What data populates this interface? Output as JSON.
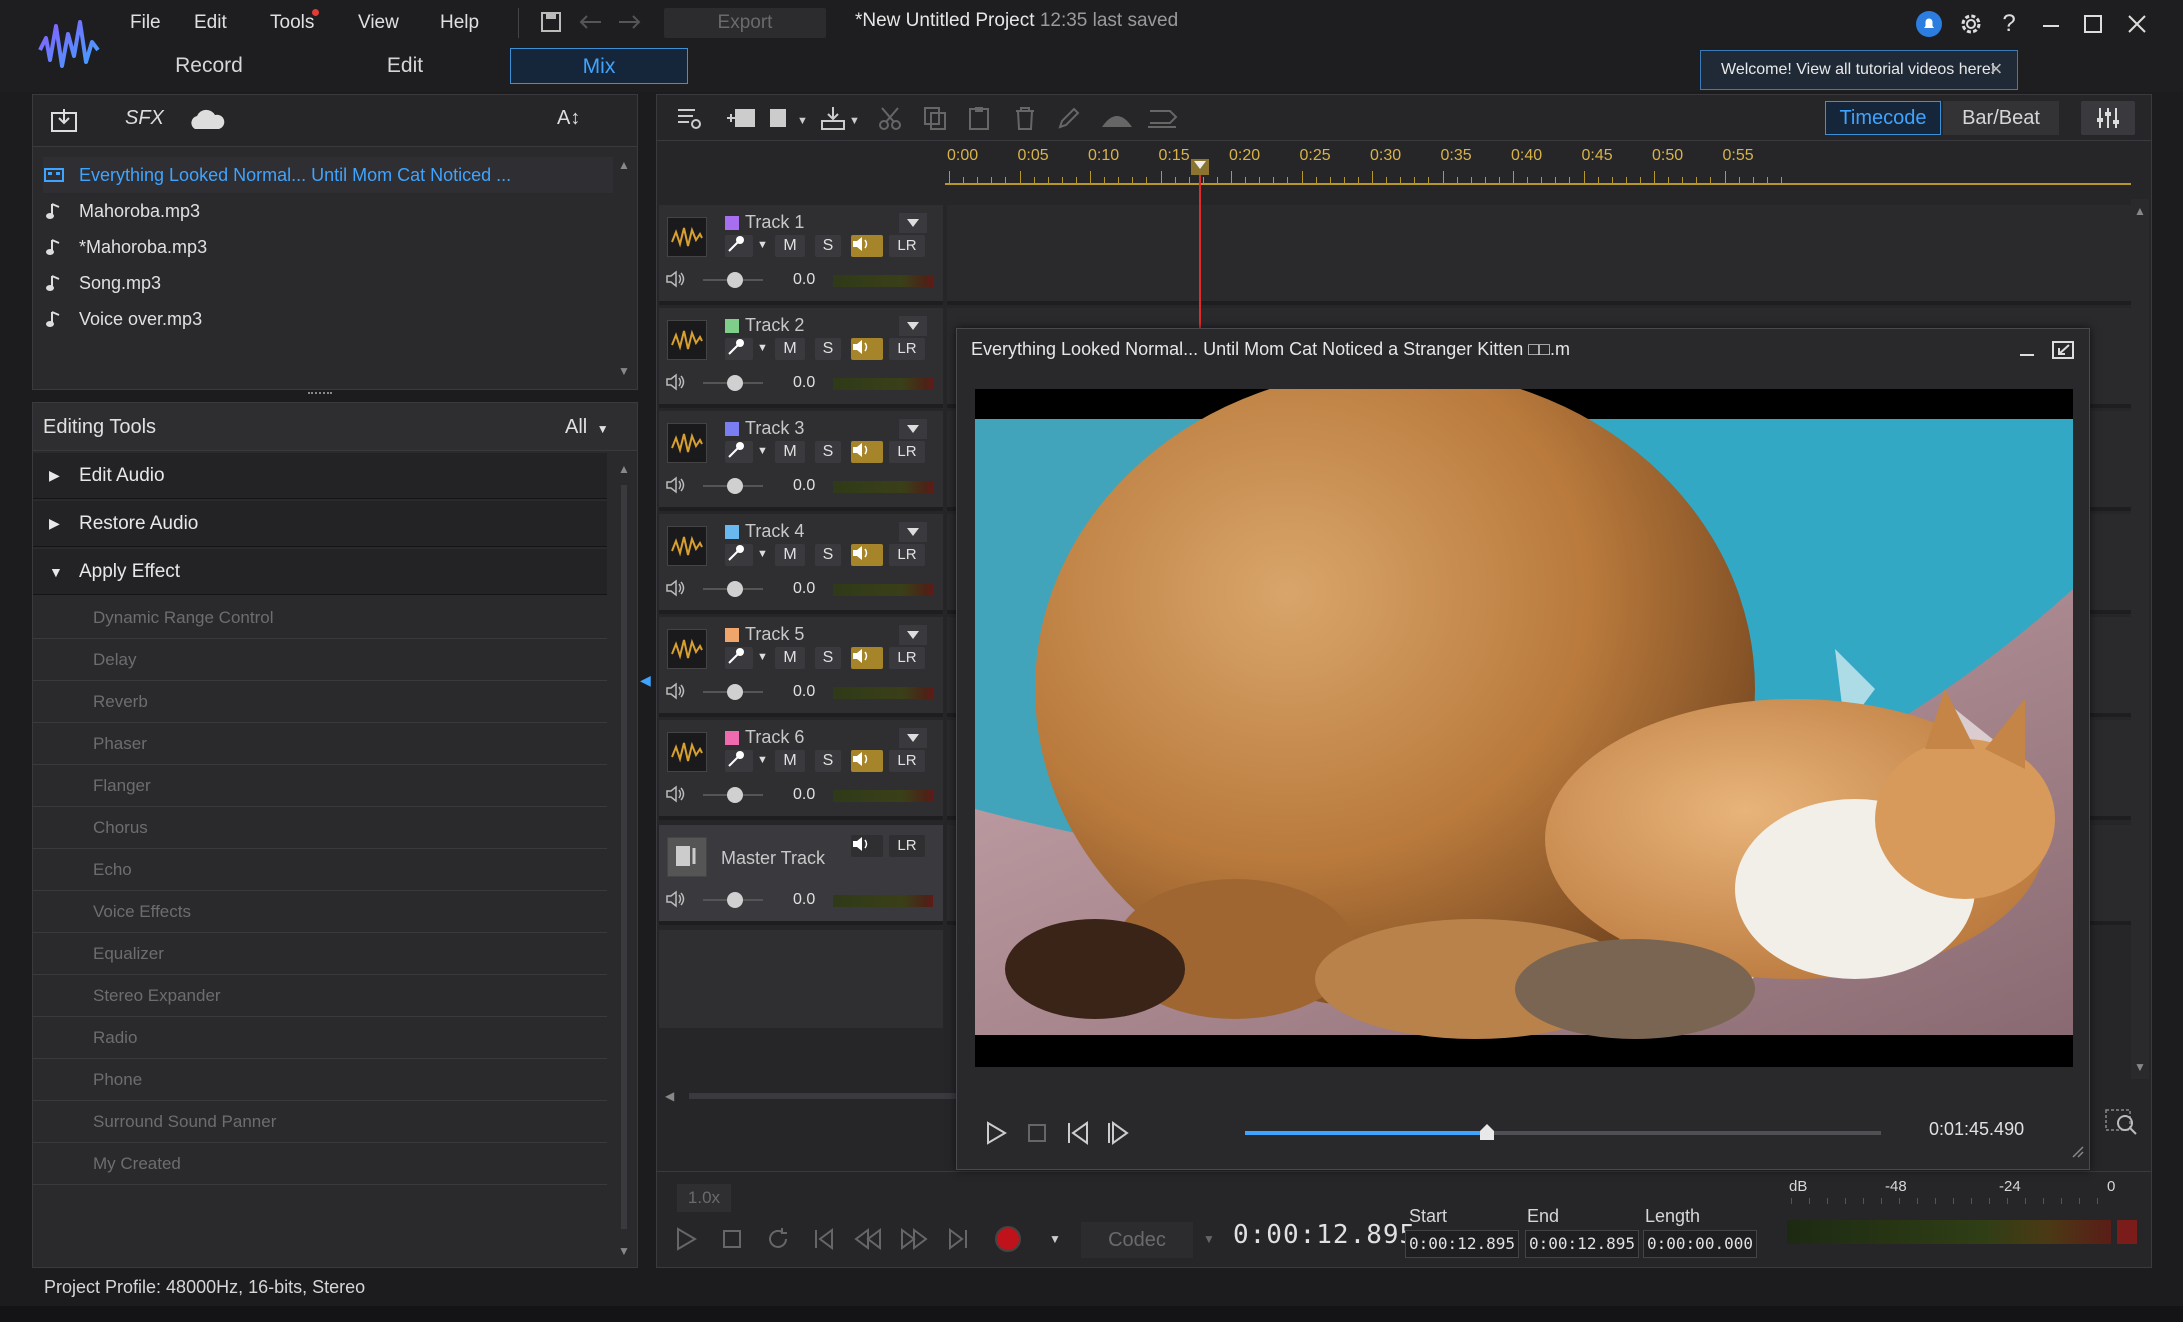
{
  "app": {
    "menu": [
      "File",
      "Edit",
      "Tools",
      "View",
      "Help"
    ],
    "export_label": "Export",
    "project_title": "*New Untitled Project",
    "project_saved": "12:35 last saved",
    "mode_tabs": [
      "Record",
      "Edit",
      "Mix"
    ],
    "active_mode": "Mix",
    "welcome_tip": "Welcome! View all tutorial videos here!"
  },
  "media": {
    "toolbar": {
      "sfx_label": "SFX",
      "text_label": "A↕"
    },
    "items": [
      {
        "label": "Everything Looked Normal... Until Mom Cat Noticed ...",
        "icon": "film-icon",
        "selected": true
      },
      {
        "label": "Mahoroba.mp3",
        "icon": "music-note-icon"
      },
      {
        "label": "*Mahoroba.mp3",
        "icon": "music-note-icon"
      },
      {
        "label": "Song.mp3",
        "icon": "music-note-icon"
      },
      {
        "label": "Voice over.mp3",
        "icon": "music-note-icon"
      }
    ]
  },
  "editing_tools": {
    "title": "Editing Tools",
    "filter": "All",
    "groups": [
      {
        "label": "Edit Audio",
        "expanded": false
      },
      {
        "label": "Restore Audio",
        "expanded": false
      },
      {
        "label": "Apply Effect",
        "expanded": true
      }
    ],
    "effects": [
      "Dynamic Range Control",
      "Delay",
      "Reverb",
      "Phaser",
      "Flanger",
      "Chorus",
      "Echo",
      "Voice Effects",
      "Equalizer",
      "Stereo Expander",
      "Radio",
      "Phone",
      "Surround Sound Panner",
      "My Created"
    ]
  },
  "status_bar": "Project Profile: 48000Hz, 16-bits, Stereo",
  "mixer": {
    "timecode_label": "Timecode",
    "barbeat_label": "Bar/Beat",
    "ruler": [
      "0:00",
      "0:05",
      "0:10",
      "0:15",
      "0:20",
      "0:25",
      "0:30",
      "0:35",
      "0:40",
      "0:45",
      "0:50",
      "0:55"
    ],
    "tracks": [
      {
        "name": "Track 1",
        "color": "#a86ef0",
        "db": "0.0"
      },
      {
        "name": "Track 2",
        "color": "#7fcf8a",
        "db": "0.0"
      },
      {
        "name": "Track 3",
        "color": "#7a7ef0",
        "db": "0.0"
      },
      {
        "name": "Track 4",
        "color": "#6ab8f0",
        "db": "0.0"
      },
      {
        "name": "Track 5",
        "color": "#f0a56a",
        "db": "0.0"
      },
      {
        "name": "Track 6",
        "color": "#f06ab0",
        "db": "0.0"
      }
    ],
    "master": {
      "name": "Master Track",
      "db": "0.0"
    },
    "button_labels": {
      "mute": "M",
      "solo": "S",
      "lr": "LR"
    }
  },
  "transport": {
    "speed": "1.0x",
    "codec": "Codec",
    "timecode": "0:00:12.895",
    "start_label": "Start",
    "end_label": "End",
    "length_label": "Length",
    "start": "0:00:12.895",
    "end": "0:00:12.895",
    "length": "0:00:00.000",
    "vu_labels": [
      "dB",
      "-48",
      "-24",
      "0"
    ]
  },
  "preview": {
    "title": "Everything Looked Normal... Until Mom Cat Noticed a Stranger Kitten □□.m",
    "time": "0:01:45.490",
    "progress": 0.38
  }
}
